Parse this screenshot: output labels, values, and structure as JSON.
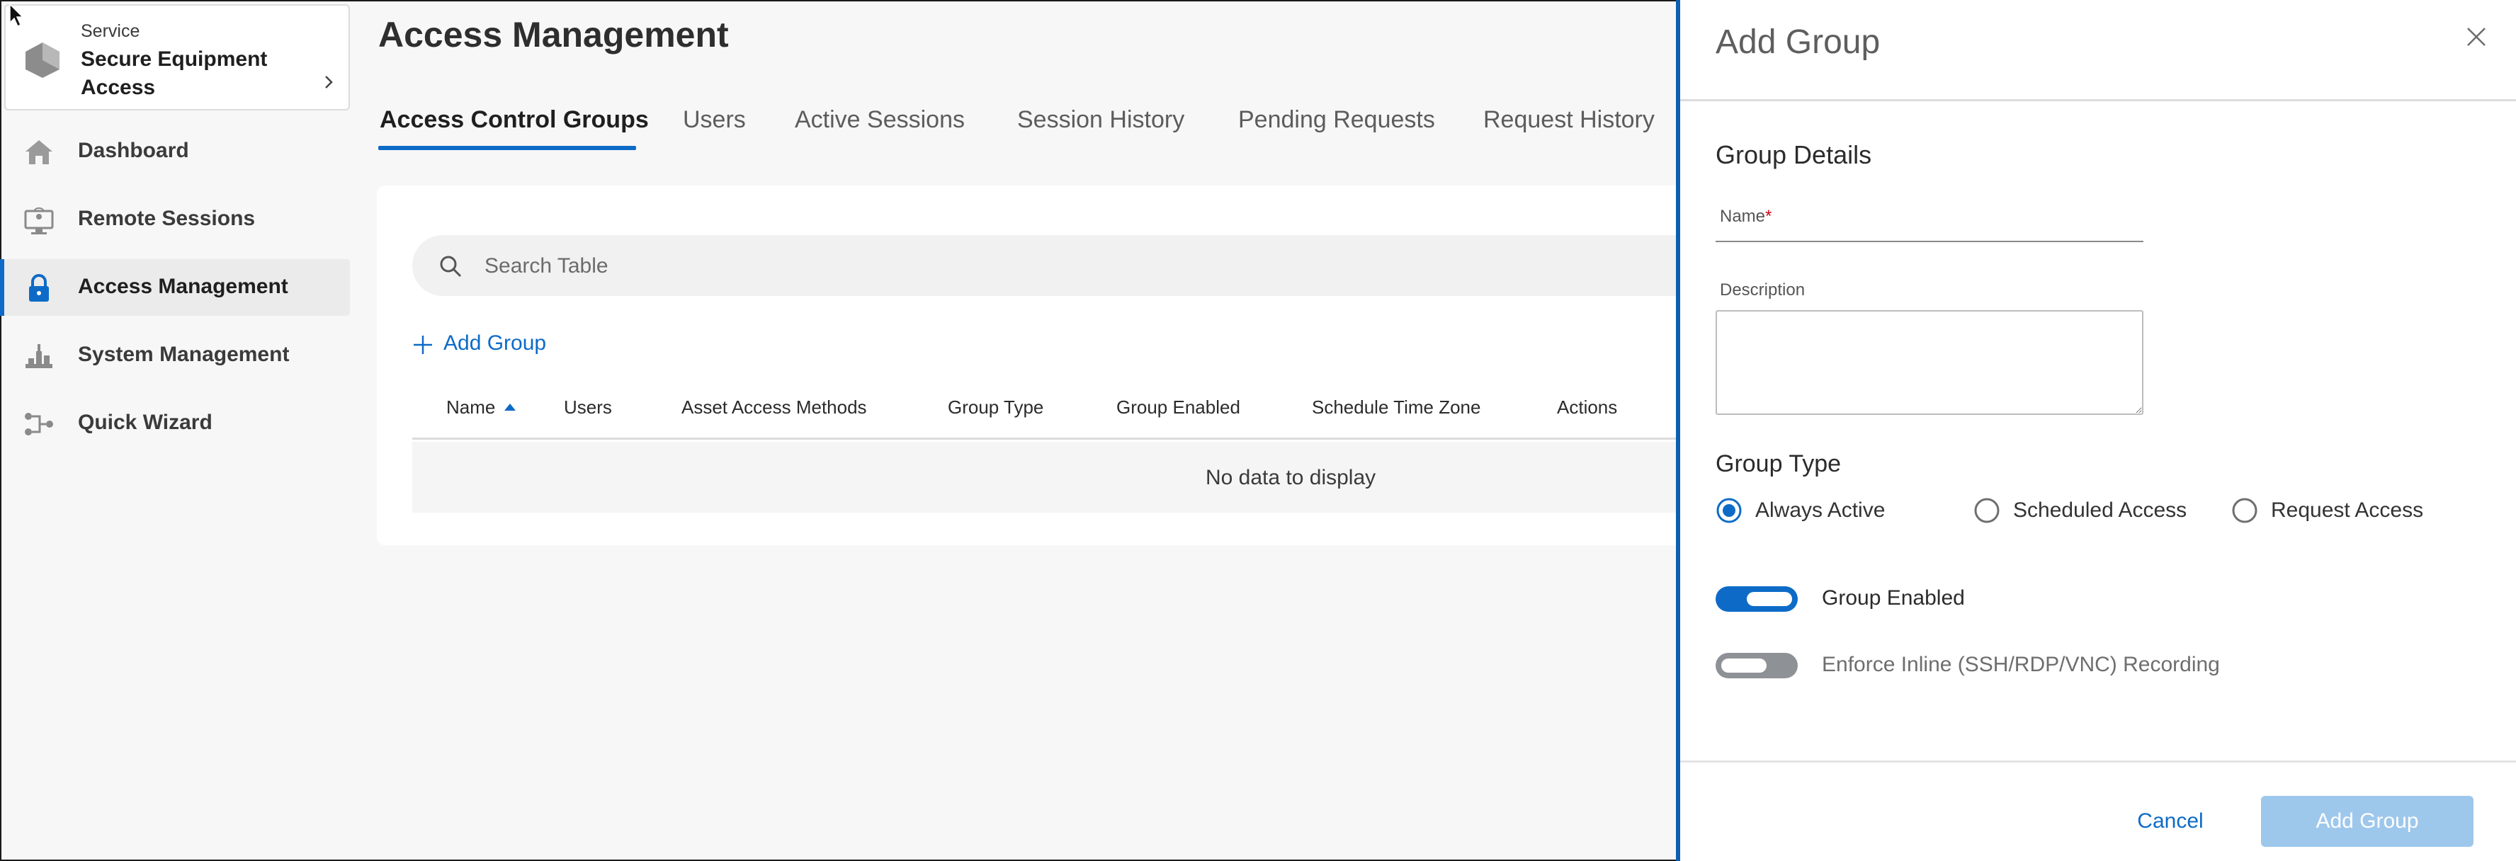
{
  "app": {
    "service_label": "Service",
    "service_name": "Secure Equipment Access"
  },
  "sidebar": {
    "items": [
      {
        "label": "Dashboard",
        "icon": "home-icon"
      },
      {
        "label": "Remote Sessions",
        "icon": "remote-sessions-icon"
      },
      {
        "label": "Access Management",
        "icon": "lock-icon",
        "active": true
      },
      {
        "label": "System Management",
        "icon": "system-management-icon"
      },
      {
        "label": "Quick Wizard",
        "icon": "wizard-flow-icon"
      }
    ]
  },
  "main": {
    "title": "Access Management",
    "tabs": [
      {
        "label": "Access Control Groups",
        "active": true
      },
      {
        "label": "Users"
      },
      {
        "label": "Active Sessions"
      },
      {
        "label": "Session History"
      },
      {
        "label": "Pending Requests"
      },
      {
        "label": "Request History"
      }
    ],
    "search": {
      "placeholder": "Search Table"
    },
    "add_group_label": "Add Group",
    "columns": [
      "Name",
      "Users",
      "Asset Access Methods",
      "Group Type",
      "Group Enabled",
      "Schedule Time Zone",
      "Actions"
    ],
    "empty_text": "No data to display"
  },
  "drawer": {
    "title": "Add Group",
    "details_heading": "Group Details",
    "name_label": "Name",
    "required_mark": "*",
    "name_value": "",
    "description_label": "Description",
    "description_value": "",
    "group_type_heading": "Group Type",
    "group_type_options": [
      {
        "label": "Always Active",
        "selected": true
      },
      {
        "label": "Scheduled Access",
        "selected": false
      },
      {
        "label": "Request Access",
        "selected": false
      }
    ],
    "toggles": [
      {
        "label": "Group Enabled",
        "on": true
      },
      {
        "label": "Enforce Inline (SSH/RDP/VNC) Recording",
        "on": false
      }
    ],
    "cancel_label": "Cancel",
    "submit_label": "Add Group"
  },
  "colors": {
    "accent": "#0d6bc7",
    "drawer_border": "#0d5fb0",
    "submit_disabled": "#9ec7ec",
    "toggle_off": "#8e9196"
  }
}
